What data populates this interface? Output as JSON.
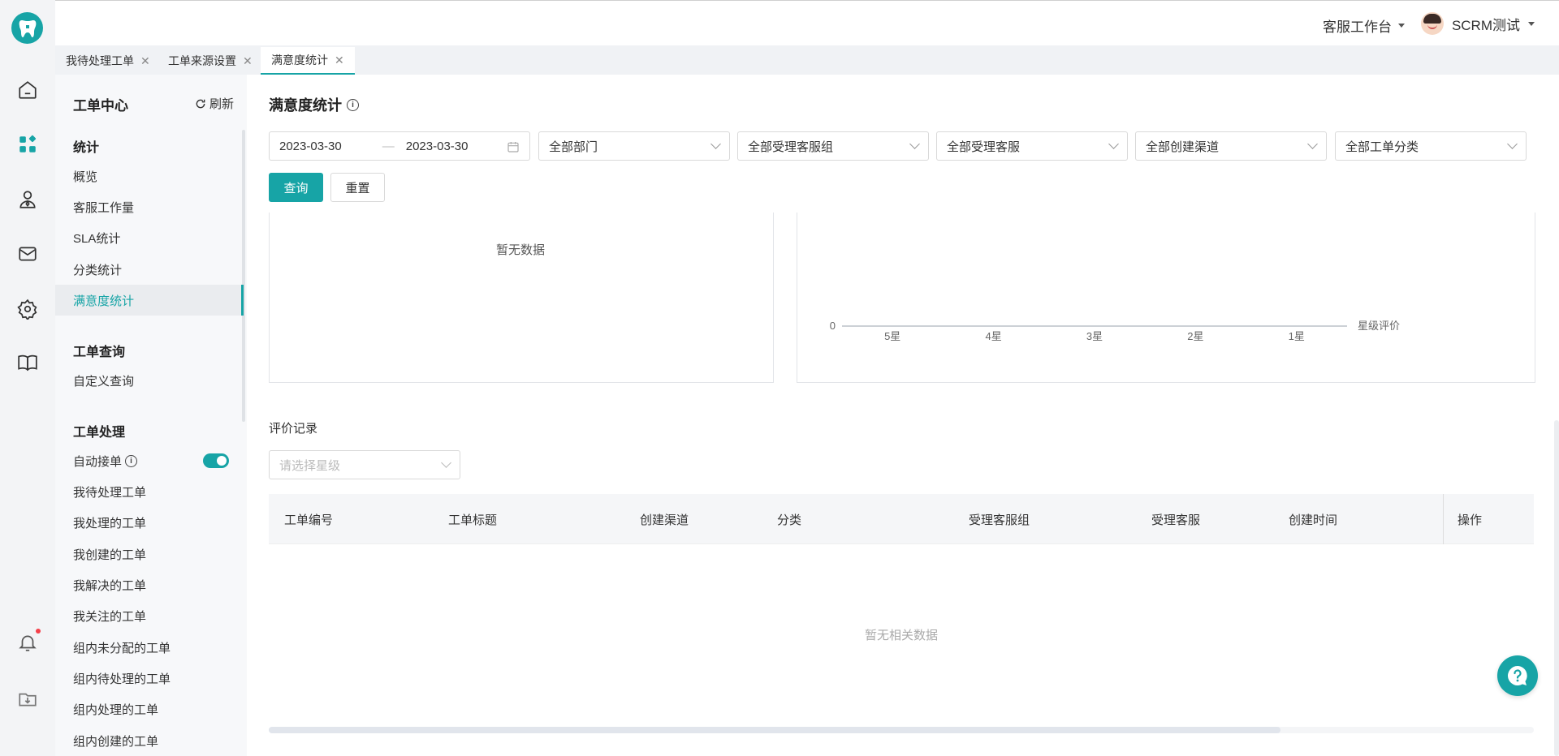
{
  "brand": {
    "accent": "#17a4a6"
  },
  "rail": {
    "icons": [
      "home-icon",
      "apps-icon",
      "customer-icon",
      "mail-icon",
      "settings-icon",
      "book-icon",
      "bell-icon",
      "download-icon"
    ]
  },
  "topbar": {
    "workspace": "客服工作台",
    "user_name": "SCRM测试"
  },
  "tabs": [
    {
      "label": "我待处理工单",
      "active": false
    },
    {
      "label": "工单来源设置",
      "active": false
    },
    {
      "label": "满意度统计",
      "active": true
    }
  ],
  "menu": {
    "title": "工单中心",
    "refresh": "刷新",
    "groups": [
      {
        "title": "统计",
        "items": [
          "概览",
          "客服工作量",
          "SLA统计",
          "分类统计",
          "满意度统计"
        ]
      },
      {
        "title": "工单查询",
        "items": [
          "自定义查询"
        ]
      },
      {
        "title": "工单处理",
        "items": [
          "自动接单",
          "我待处理工单",
          "我处理的工单",
          "我创建的工单",
          "我解决的工单",
          "我关注的工单",
          "组内未分配的工单",
          "组内待处理的工单",
          "组内处理的工单",
          "组内创建的工单"
        ]
      }
    ],
    "active_item": "满意度统计",
    "auto_accept_on": true
  },
  "main": {
    "title": "满意度统计",
    "filters": {
      "date_start": "2023-03-30",
      "date_end": "2023-03-30",
      "department": "全部部门",
      "service_group": "全部受理客服组",
      "agent": "全部受理客服",
      "channel": "全部创建渠道",
      "category": "全部工单分类"
    },
    "query_btn": "查询",
    "reset_btn": "重置",
    "left_chart_empty": "暂无数据",
    "records_title": "评价记录",
    "star_select_placeholder": "请选择星级",
    "table": {
      "headers": [
        "工单编号",
        "工单标题",
        "创建渠道",
        "分类",
        "受理客服组",
        "受理客服",
        "创建时间",
        "操作"
      ],
      "empty": "暂无相关数据"
    }
  },
  "chart_data": {
    "type": "bar",
    "categories": [
      "5星",
      "4星",
      "3星",
      "2星",
      "1星"
    ],
    "values": [
      0,
      0,
      0,
      0,
      0
    ],
    "xlabel": "星级评价",
    "y_ticks": [
      "0"
    ]
  }
}
